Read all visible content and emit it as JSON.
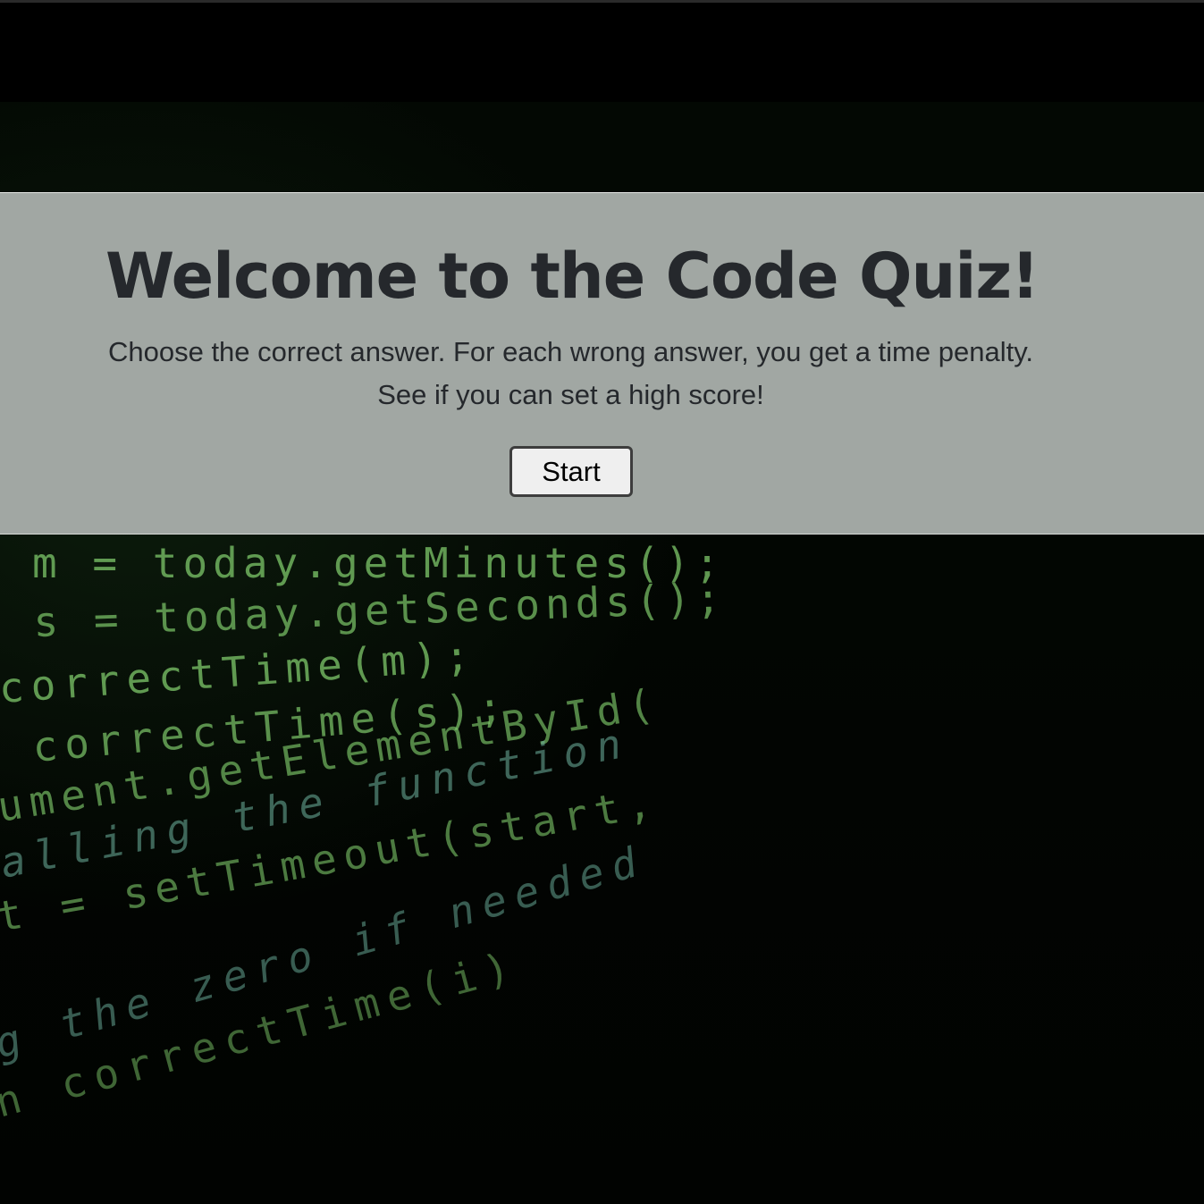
{
  "hero": {
    "title": "Welcome to the Code Quiz!",
    "line1": "Choose the correct answer. For each wrong answer, you get a time penalty.",
    "line2": "See if you can set a high score!",
    "start_label": "Start"
  },
  "background_code": [
    "m  =  today.getMinutes();",
    "s  =  today.getSeconds();",
    "correctTime(m);",
    " correctTime(s);",
    "ument.getElementById(",
    "alling the function",
    " t  =  setTimeout(start,",
    "g  the zero if needed",
    "n  correctTime(i)"
  ],
  "colors": {
    "hero_background": "#a1a7a3",
    "text": "#25282c",
    "code_green": "#7ec86a",
    "code_operator": "#d2642a"
  }
}
